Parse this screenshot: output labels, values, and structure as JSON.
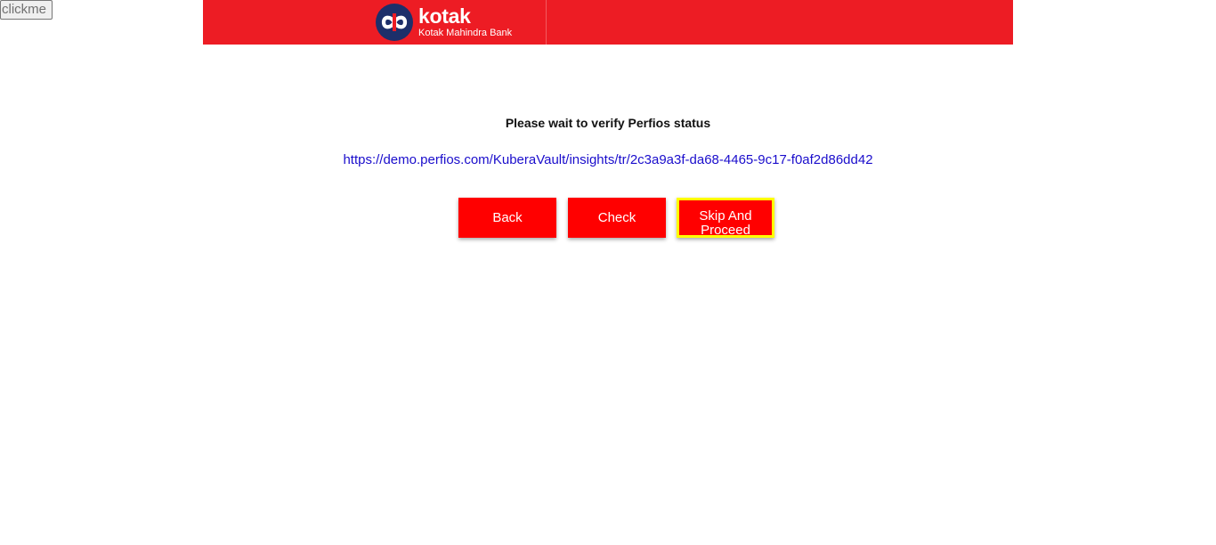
{
  "debug": {
    "clickme_label": "clickme"
  },
  "header": {
    "brand": {
      "name": "kotak",
      "subtitle": "Kotak Mahindra Bank"
    },
    "colors": {
      "background": "#ed1c24",
      "logo_circle": "#1d2f6a",
      "logo_text": "#ffffff"
    }
  },
  "main": {
    "message": "Please wait to verify Perfios status",
    "link_text": "https://demo.perfios.com/KuberaVault/insights/tr/2c3a9a3f-da68-4465-9c17-f0af2d86dd42",
    "buttons": {
      "back_label": "Back",
      "check_label": "Check",
      "skip_label": "Skip And Proceed"
    }
  },
  "colors": {
    "button_background": "#ff0000",
    "button_text": "#ffffff",
    "focus_outline": "#ffff00",
    "link": "#1a0dcc"
  }
}
